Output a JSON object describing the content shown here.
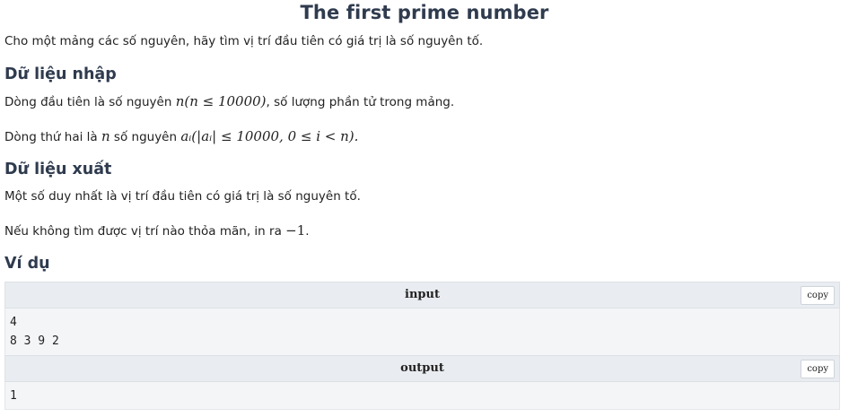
{
  "title": "The first prime number",
  "intro": "Cho một mảng các số nguyên, hãy tìm vị trí đầu tiên có giá trị là số nguyên tố.",
  "input_section": {
    "heading": "Dữ liệu nhập",
    "line1_prefix": "Dòng đầu tiên là số nguyên ",
    "line1_math": "n(n ≤ 10000)",
    "line1_suffix": ", số lượng phần tử trong mảng.",
    "line2_prefix": "Dòng thứ hai là ",
    "line2_math_n": "n",
    "line2_mid": " số nguyên ",
    "line2_math": "aᵢ(|aᵢ| ≤ 10000, 0 ≤ i < n).",
    "line2_suffix": ""
  },
  "output_section": {
    "heading": "Dữ liệu xuất",
    "line1": "Một số duy nhất là vị trí đầu tiên có giá trị là số nguyên tố.",
    "line2_prefix": "Nếu không tìm được vị trí nào thỏa mãn, in ra ",
    "line2_math": "−1",
    "line2_suffix": "."
  },
  "example": {
    "heading": "Ví dụ",
    "input_label": "input",
    "input_text": "4\n8 3 9 2",
    "output_label": "output",
    "output_text": "1",
    "copy_label": "copy"
  }
}
